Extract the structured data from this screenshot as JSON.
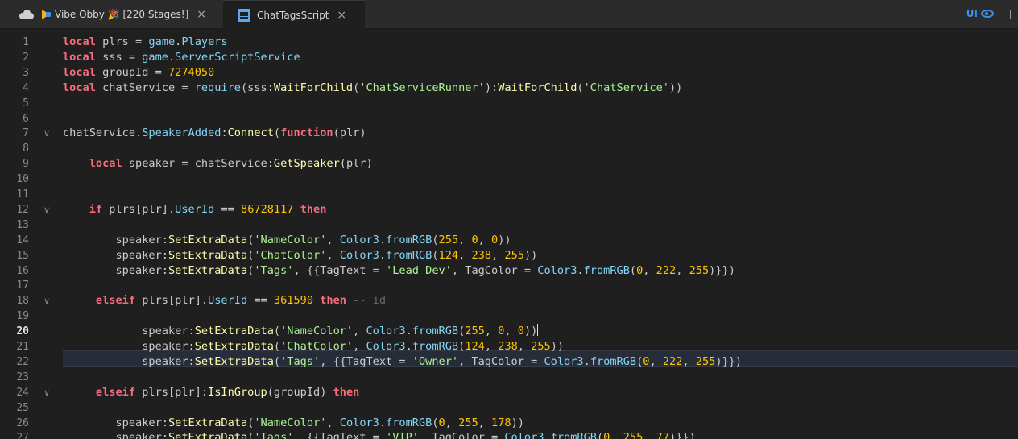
{
  "tabs": {
    "place": {
      "label": "Vibe Obby 🎉 [220 Stages!]",
      "close": "×"
    },
    "script": {
      "label": "ChatTagsScript",
      "close": "×"
    }
  },
  "toolbar": {
    "ui_label": "UI"
  },
  "editor": {
    "active_line": 20,
    "lines": [
      {
        "n": "1",
        "fold": "",
        "tokens": [
          [
            "kw",
            "local"
          ],
          [
            "tx",
            " plrs = "
          ],
          [
            "bi",
            "game"
          ],
          [
            "tx",
            "."
          ],
          [
            "bi",
            "Players"
          ]
        ]
      },
      {
        "n": "2",
        "fold": "",
        "tokens": [
          [
            "kw",
            "local"
          ],
          [
            "tx",
            " sss = "
          ],
          [
            "bi",
            "game"
          ],
          [
            "tx",
            "."
          ],
          [
            "bi",
            "ServerScriptService"
          ]
        ]
      },
      {
        "n": "3",
        "fold": "",
        "tokens": [
          [
            "kw",
            "local"
          ],
          [
            "tx",
            " groupId = "
          ],
          [
            "num",
            "7274050"
          ]
        ]
      },
      {
        "n": "4",
        "fold": "",
        "tokens": [
          [
            "kw",
            "local"
          ],
          [
            "tx",
            " chatService = "
          ],
          [
            "bi",
            "require"
          ],
          [
            "tx",
            "(sss:"
          ],
          [
            "fn",
            "WaitForChild"
          ],
          [
            "tx",
            "("
          ],
          [
            "str",
            "'ChatServiceRunner'"
          ],
          [
            "tx",
            "):"
          ],
          [
            "fn",
            "WaitForChild"
          ],
          [
            "tx",
            "("
          ],
          [
            "str",
            "'ChatService'"
          ],
          [
            "tx",
            "))"
          ]
        ]
      },
      {
        "n": "5",
        "fold": "",
        "tokens": []
      },
      {
        "n": "6",
        "fold": "",
        "tokens": []
      },
      {
        "n": "7",
        "fold": "v",
        "tokens": [
          [
            "tx",
            "chatService."
          ],
          [
            "bi",
            "SpeakerAdded"
          ],
          [
            "tx",
            ":"
          ],
          [
            "fn",
            "Connect"
          ],
          [
            "tx",
            "("
          ],
          [
            "kw",
            "function"
          ],
          [
            "tx",
            "(plr)"
          ]
        ]
      },
      {
        "n": "8",
        "fold": "",
        "tokens": []
      },
      {
        "n": "9",
        "fold": "",
        "tokens": [
          [
            "tx",
            "    "
          ],
          [
            "kw",
            "local"
          ],
          [
            "tx",
            " speaker = chatService:"
          ],
          [
            "fn",
            "GetSpeaker"
          ],
          [
            "tx",
            "(plr)"
          ]
        ]
      },
      {
        "n": "10",
        "fold": "",
        "tokens": []
      },
      {
        "n": "11",
        "fold": "",
        "tokens": []
      },
      {
        "n": "12",
        "fold": "v",
        "tokens": [
          [
            "tx",
            "    "
          ],
          [
            "kw",
            "if"
          ],
          [
            "tx",
            " plrs[plr]."
          ],
          [
            "bi",
            "UserId"
          ],
          [
            "tx",
            " == "
          ],
          [
            "num",
            "86728117"
          ],
          [
            "tx",
            " "
          ],
          [
            "kw",
            "then"
          ]
        ]
      },
      {
        "n": "13",
        "fold": "",
        "tokens": []
      },
      {
        "n": "14",
        "fold": "",
        "tokens": [
          [
            "tx",
            "        speaker:"
          ],
          [
            "fn",
            "SetExtraData"
          ],
          [
            "tx",
            "("
          ],
          [
            "str",
            "'NameColor'"
          ],
          [
            "tx",
            ", "
          ],
          [
            "bi",
            "Color3"
          ],
          [
            "tx",
            "."
          ],
          [
            "bi",
            "fromRGB"
          ],
          [
            "tx",
            "("
          ],
          [
            "num",
            "255"
          ],
          [
            "tx",
            ", "
          ],
          [
            "num",
            "0"
          ],
          [
            "tx",
            ", "
          ],
          [
            "num",
            "0"
          ],
          [
            "tx",
            "))"
          ]
        ]
      },
      {
        "n": "15",
        "fold": "",
        "tokens": [
          [
            "tx",
            "        speaker:"
          ],
          [
            "fn",
            "SetExtraData"
          ],
          [
            "tx",
            "("
          ],
          [
            "str",
            "'ChatColor'"
          ],
          [
            "tx",
            ", "
          ],
          [
            "bi",
            "Color3"
          ],
          [
            "tx",
            "."
          ],
          [
            "bi",
            "fromRGB"
          ],
          [
            "tx",
            "("
          ],
          [
            "num",
            "124"
          ],
          [
            "tx",
            ", "
          ],
          [
            "num",
            "238"
          ],
          [
            "tx",
            ", "
          ],
          [
            "num",
            "255"
          ],
          [
            "tx",
            "))"
          ]
        ]
      },
      {
        "n": "16",
        "fold": "",
        "tokens": [
          [
            "tx",
            "        speaker:"
          ],
          [
            "fn",
            "SetExtraData"
          ],
          [
            "tx",
            "("
          ],
          [
            "str",
            "'Tags'"
          ],
          [
            "tx",
            ", {{TagText = "
          ],
          [
            "str",
            "'Lead Dev'"
          ],
          [
            "tx",
            ", TagColor = "
          ],
          [
            "bi",
            "Color3"
          ],
          [
            "tx",
            "."
          ],
          [
            "bi",
            "fromRGB"
          ],
          [
            "tx",
            "("
          ],
          [
            "num",
            "0"
          ],
          [
            "tx",
            ", "
          ],
          [
            "num",
            "222"
          ],
          [
            "tx",
            ", "
          ],
          [
            "num",
            "255"
          ],
          [
            "tx",
            ")}})"
          ]
        ]
      },
      {
        "n": "17",
        "fold": "",
        "tokens": []
      },
      {
        "n": "18",
        "fold": "v",
        "tokens": [
          [
            "tx",
            "     "
          ],
          [
            "kw",
            "elseif"
          ],
          [
            "tx",
            " plrs[plr]."
          ],
          [
            "bi",
            "UserId"
          ],
          [
            "tx",
            " == "
          ],
          [
            "num",
            "361590"
          ],
          [
            "tx",
            " "
          ],
          [
            "kw",
            "then"
          ],
          [
            "tx",
            " "
          ],
          [
            "cm",
            "-- id"
          ]
        ]
      },
      {
        "n": "19",
        "fold": "",
        "tokens": []
      },
      {
        "n": "20",
        "fold": "",
        "caret": true,
        "tokens": [
          [
            "tx",
            "            speaker:"
          ],
          [
            "fn",
            "SetExtraData"
          ],
          [
            "tx",
            "("
          ],
          [
            "str",
            "'NameColor'"
          ],
          [
            "tx",
            ", "
          ],
          [
            "bi",
            "Color3"
          ],
          [
            "tx",
            "."
          ],
          [
            "bi",
            "fromRGB"
          ],
          [
            "tx",
            "("
          ],
          [
            "num",
            "255"
          ],
          [
            "tx",
            ", "
          ],
          [
            "num",
            "0"
          ],
          [
            "tx",
            ", "
          ],
          [
            "num",
            "0"
          ],
          [
            "tx",
            "))"
          ]
        ]
      },
      {
        "n": "21",
        "fold": "",
        "tokens": [
          [
            "tx",
            "            speaker:"
          ],
          [
            "fn",
            "SetExtraData"
          ],
          [
            "tx",
            "("
          ],
          [
            "str",
            "'ChatColor'"
          ],
          [
            "tx",
            ", "
          ],
          [
            "bi",
            "Color3"
          ],
          [
            "tx",
            "."
          ],
          [
            "bi",
            "fromRGB"
          ],
          [
            "tx",
            "("
          ],
          [
            "num",
            "124"
          ],
          [
            "tx",
            ", "
          ],
          [
            "num",
            "238"
          ],
          [
            "tx",
            ", "
          ],
          [
            "num",
            "255"
          ],
          [
            "tx",
            "))"
          ]
        ]
      },
      {
        "n": "22",
        "fold": "",
        "tokens": [
          [
            "tx",
            "            speaker:"
          ],
          [
            "fn",
            "SetExtraData"
          ],
          [
            "tx",
            "("
          ],
          [
            "str",
            "'Tags'"
          ],
          [
            "tx",
            ", {{TagText = "
          ],
          [
            "str",
            "'Owner'"
          ],
          [
            "tx",
            ", TagColor = "
          ],
          [
            "bi",
            "Color3"
          ],
          [
            "tx",
            "."
          ],
          [
            "bi",
            "fromRGB"
          ],
          [
            "tx",
            "("
          ],
          [
            "num",
            "0"
          ],
          [
            "tx",
            ", "
          ],
          [
            "num",
            "222"
          ],
          [
            "tx",
            ", "
          ],
          [
            "num",
            "255"
          ],
          [
            "tx",
            ")}})"
          ]
        ]
      },
      {
        "n": "23",
        "fold": "",
        "tokens": []
      },
      {
        "n": "24",
        "fold": "v",
        "tokens": [
          [
            "tx",
            "     "
          ],
          [
            "kw",
            "elseif"
          ],
          [
            "tx",
            " plrs[plr]:"
          ],
          [
            "fn",
            "IsInGroup"
          ],
          [
            "tx",
            "(groupId) "
          ],
          [
            "kw",
            "then"
          ]
        ]
      },
      {
        "n": "25",
        "fold": "",
        "tokens": []
      },
      {
        "n": "26",
        "fold": "",
        "tokens": [
          [
            "tx",
            "        speaker:"
          ],
          [
            "fn",
            "SetExtraData"
          ],
          [
            "tx",
            "("
          ],
          [
            "str",
            "'NameColor'"
          ],
          [
            "tx",
            ", "
          ],
          [
            "bi",
            "Color3"
          ],
          [
            "tx",
            "."
          ],
          [
            "bi",
            "fromRGB"
          ],
          [
            "tx",
            "("
          ],
          [
            "num",
            "0"
          ],
          [
            "tx",
            ", "
          ],
          [
            "num",
            "255"
          ],
          [
            "tx",
            ", "
          ],
          [
            "num",
            "178"
          ],
          [
            "tx",
            "))"
          ]
        ]
      },
      {
        "n": "27",
        "fold": "",
        "tokens": [
          [
            "tx",
            "        speaker:"
          ],
          [
            "fn",
            "SetExtraData"
          ],
          [
            "tx",
            "("
          ],
          [
            "str",
            "'Tags'"
          ],
          [
            "tx",
            ", {{TagText = "
          ],
          [
            "str",
            "'VIP'"
          ],
          [
            "tx",
            ", TagColor = "
          ],
          [
            "bi",
            "Color3"
          ],
          [
            "tx",
            "."
          ],
          [
            "bi",
            "fromRGB"
          ],
          [
            "tx",
            "("
          ],
          [
            "num",
            "0"
          ],
          [
            "tx",
            ", "
          ],
          [
            "num",
            "255"
          ],
          [
            "tx",
            ", "
          ],
          [
            "num",
            "77"
          ],
          [
            "tx",
            ")}})"
          ]
        ]
      }
    ]
  },
  "colors": {
    "keyword": "#f86d7c",
    "builtin": "#84d6f7",
    "method": "#fdfbac",
    "string": "#adf195",
    "number": "#ffc600",
    "comment": "#666666",
    "accent": "#3b8ff0"
  }
}
